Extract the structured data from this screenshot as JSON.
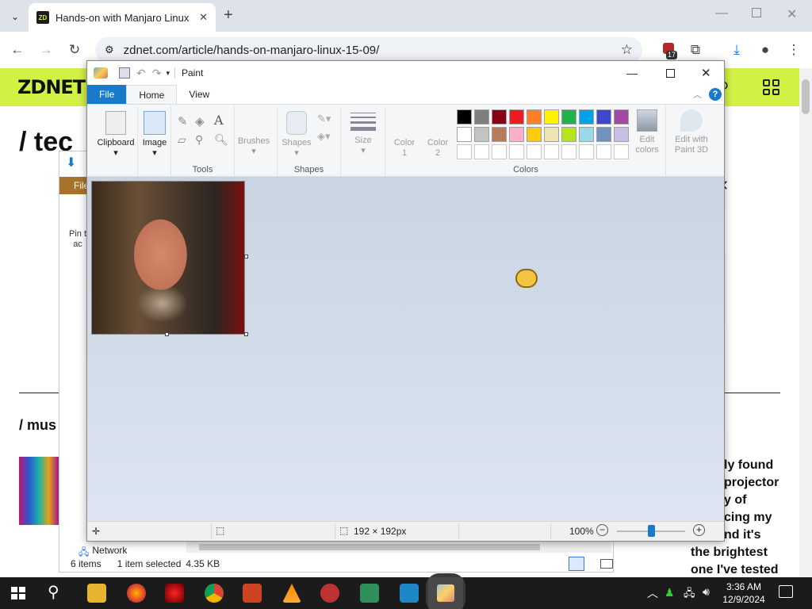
{
  "browser": {
    "tab_title": "Hands-on with Manjaro Linux 1",
    "url": "zdnet.com/article/hands-on-manjaro-linux-15-09/",
    "badge_count": "17",
    "favicon_text": "ZD"
  },
  "site": {
    "logo": "ZDNET",
    "heading_fragment": "/ tec",
    "section_fragment": "/  mus",
    "side_text": [
      "ly found",
      "projector",
      "y of",
      "cing my",
      "nd it's",
      "the brightest",
      "one I've tested"
    ]
  },
  "explorer": {
    "file_tab": "File",
    "pin_label": [
      "Pin t",
      "ac"
    ],
    "nav_item": "Network",
    "status_items": "6 items",
    "status_selected": "1 item selected",
    "status_size": "4.35 KB"
  },
  "paint": {
    "title": "Paint",
    "tabs": [
      "File",
      "Home",
      "View"
    ],
    "groups": {
      "clipboard": "Clipboard",
      "image": "Image",
      "tools": "Tools",
      "brushes": "Brushes",
      "shapes": "Shapes",
      "shapes_group": "Shapes",
      "size": "Size",
      "color1": [
        "Color",
        "1"
      ],
      "color2": [
        "Color",
        "2"
      ],
      "edit_colors": [
        "Edit",
        "colors"
      ],
      "edit_paint3d": [
        "Edit with",
        "Paint 3D"
      ],
      "colors_group": "Colors"
    },
    "palette_row1": [
      "#000000",
      "#7f7f7f",
      "#880015",
      "#ed1c24",
      "#ff7f27",
      "#fff200",
      "#22b14c",
      "#00a2e8",
      "#3f48cc",
      "#a349a4"
    ],
    "palette_row2": [
      "#ffffff",
      "#c3c3c3",
      "#b97a57",
      "#ffaec9",
      "#ffc90e",
      "#efe4b0",
      "#b5e61d",
      "#99d9ea",
      "#7092be",
      "#c8bfe7"
    ],
    "palette_row3": [
      "#ffffff",
      "#ffffff",
      "#ffffff",
      "#ffffff",
      "#ffffff",
      "#ffffff",
      "#ffffff",
      "#ffffff",
      "#ffffff",
      "#ffffff"
    ],
    "status": {
      "dimensions": "192 × 192px",
      "zoom": "100%",
      "zoom_fraction": 0.5
    },
    "help": "?"
  },
  "taskbar": {
    "time": "3:36 AM",
    "date": "12/9/2024"
  },
  "colors": {
    "zdnet_green": "#d2f145",
    "paint_blue": "#1979ca",
    "taskbar": "#1b1b1b"
  }
}
